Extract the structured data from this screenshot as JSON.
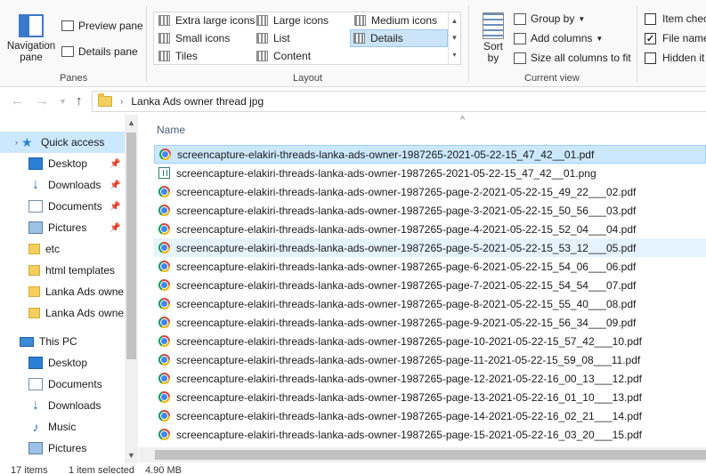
{
  "ribbon": {
    "panes": {
      "navigation_pane": "Navigation pane",
      "preview_pane": "Preview pane",
      "details_pane": "Details pane",
      "group_label": "Panes"
    },
    "layout": {
      "items": [
        "Extra large icons",
        "Large icons",
        "Medium icons",
        "Small icons",
        "List",
        "Details",
        "Tiles",
        "Content"
      ],
      "selected": "Details",
      "group_label": "Layout"
    },
    "current_view": {
      "sort_by": "Sort by",
      "group_by": "Group by",
      "add_columns": "Add columns",
      "size_all_columns": "Size all columns to fit",
      "group_label": "Current view"
    },
    "show_hide": {
      "item_check_boxes": "Item chec",
      "file_name_extensions": "File name",
      "file_name_extensions_checked": true,
      "hidden_items": "Hidden it"
    }
  },
  "address": {
    "path": "Lanka Ads owner thread jpg"
  },
  "navpane": {
    "quick_access": "Quick access",
    "quick_items": [
      {
        "label": "Desktop",
        "pinned": true
      },
      {
        "label": "Downloads",
        "pinned": true
      },
      {
        "label": "Documents",
        "pinned": true
      },
      {
        "label": "Pictures",
        "pinned": true
      },
      {
        "label": "etc",
        "pinned": false
      },
      {
        "label": "html templates",
        "pinned": false
      },
      {
        "label": "Lanka Ads owne",
        "pinned": false
      },
      {
        "label": "Lanka Ads owne",
        "pinned": false
      }
    ],
    "this_pc": "This PC",
    "pc_items": [
      "Desktop",
      "Documents",
      "Downloads",
      "Music",
      "Pictures"
    ]
  },
  "filelist": {
    "column_name": "Name",
    "files": [
      "screencapture-elakiri-threads-lanka-ads-owner-1987265-2021-05-22-15_47_42__01.pdf",
      "screencapture-elakiri-threads-lanka-ads-owner-1987265-2021-05-22-15_47_42__01.png",
      "screencapture-elakiri-threads-lanka-ads-owner-1987265-page-2-2021-05-22-15_49_22___02.pdf",
      "screencapture-elakiri-threads-lanka-ads-owner-1987265-page-3-2021-05-22-15_50_56___03.pdf",
      "screencapture-elakiri-threads-lanka-ads-owner-1987265-page-4-2021-05-22-15_52_04___04.pdf",
      "screencapture-elakiri-threads-lanka-ads-owner-1987265-page-5-2021-05-22-15_53_12___05.pdf",
      "screencapture-elakiri-threads-lanka-ads-owner-1987265-page-6-2021-05-22-15_54_06___06.pdf",
      "screencapture-elakiri-threads-lanka-ads-owner-1987265-page-7-2021-05-22-15_54_54___07.pdf",
      "screencapture-elakiri-threads-lanka-ads-owner-1987265-page-8-2021-05-22-15_55_40___08.pdf",
      "screencapture-elakiri-threads-lanka-ads-owner-1987265-page-9-2021-05-22-15_56_34___09.pdf",
      "screencapture-elakiri-threads-lanka-ads-owner-1987265-page-10-2021-05-22-15_57_42___10.pdf",
      "screencapture-elakiri-threads-lanka-ads-owner-1987265-page-11-2021-05-22-15_59_08___11.pdf",
      "screencapture-elakiri-threads-lanka-ads-owner-1987265-page-12-2021-05-22-16_00_13___12.pdf",
      "screencapture-elakiri-threads-lanka-ads-owner-1987265-page-13-2021-05-22-16_01_10___13.pdf",
      "screencapture-elakiri-threads-lanka-ads-owner-1987265-page-14-2021-05-22-16_02_21___14.pdf",
      "screencapture-elakiri-threads-lanka-ads-owner-1987265-page-15-2021-05-22-16_03_20___15.pdf"
    ],
    "selected_index": 0,
    "hover_index": 5
  },
  "status": {
    "item_count": "17 items",
    "selection": "1 item selected",
    "size": "4.90 MB"
  },
  "colors": {
    "selection": "#cce8ff",
    "hover": "#e5f3ff",
    "accent": "#2b7fd4"
  }
}
